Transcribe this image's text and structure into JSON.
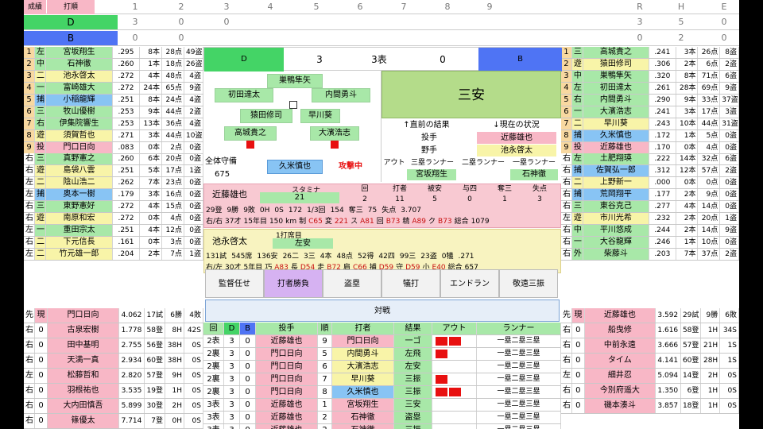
{
  "scoreboard": {
    "corner": [
      "成績",
      "打順"
    ],
    "innings": [
      "1",
      "2",
      "3",
      "4",
      "5",
      "6",
      "7",
      "8",
      "9"
    ],
    "totals_head": [
      "R",
      "H",
      "E"
    ],
    "teams": [
      {
        "name": "D",
        "runs": [
          "3",
          "0",
          "0",
          "",
          "",
          "",
          "",
          "",
          ""
        ],
        "totals": [
          "3",
          "5",
          "0"
        ]
      },
      {
        "name": "B",
        "runs": [
          "0",
          "0",
          "",
          "",
          "",
          "",
          "",
          "",
          ""
        ],
        "totals": [
          "0",
          "2",
          "0"
        ]
      }
    ]
  },
  "left_lineup": [
    {
      "no": "1",
      "pos": "左",
      "name": "宮坂翔生",
      "avg": ".295",
      "hr": "8本",
      "rbi": "28点",
      "sb": "49盗"
    },
    {
      "no": "2",
      "pos": "中",
      "name": "石神徹",
      "avg": ".260",
      "hr": "1本",
      "rbi": "18点",
      "sb": "26盗"
    },
    {
      "no": "3",
      "pos": "二",
      "name": "池永啓太",
      "avg": ".272",
      "hr": "4本",
      "rbi": "48点",
      "sb": "4盗"
    },
    {
      "no": "4",
      "pos": "一",
      "name": "富崎雄大",
      "avg": ".272",
      "hr": "24本",
      "rbi": "65点",
      "sb": "9盗"
    },
    {
      "no": "5",
      "pos": "捕",
      "name": "小稲龍輝",
      "avg": ".251",
      "hr": "8本",
      "rbi": "24点",
      "sb": "4盗"
    },
    {
      "no": "6",
      "pos": "三",
      "name": "牧山優樹",
      "avg": ".253",
      "hr": "9本",
      "rbi": "44点",
      "sb": "2盗"
    },
    {
      "no": "7",
      "pos": "右",
      "name": "伊集院響生",
      "avg": ".253",
      "hr": "13本",
      "rbi": "36点",
      "sb": "4盗"
    },
    {
      "no": "8",
      "pos": "遊",
      "name": "須賀哲也",
      "avg": ".271",
      "hr": "3本",
      "rbi": "44点",
      "sb": "10盗"
    },
    {
      "no": "9",
      "pos": "投",
      "name": "門口日向",
      "avg": ".083",
      "hr": "0本",
      "rbi": "2点",
      "sb": "0盗"
    }
  ],
  "left_bench": [
    {
      "bat": "右",
      "pos": "三",
      "name": "真野憲之",
      "avg": ".260",
      "hr": "6本",
      "rbi": "20点",
      "sb": "0盗"
    },
    {
      "bat": "右",
      "pos": "遊",
      "name": "島袋八雲",
      "avg": ".251",
      "hr": "5本",
      "rbi": "17点",
      "sb": "1盗"
    },
    {
      "bat": "左",
      "pos": "二",
      "name": "陰山浩二",
      "avg": ".262",
      "hr": "7本",
      "rbi": "23点",
      "sb": "0盗"
    },
    {
      "bat": "左",
      "pos": "捕",
      "name": "奥本一樹",
      "avg": ".179",
      "hr": "3本",
      "rbi": "16点",
      "sb": "0盗"
    },
    {
      "bat": "右",
      "pos": "三",
      "name": "東野憲好",
      "avg": ".272",
      "hr": "4本",
      "rbi": "15点",
      "sb": "0盗"
    },
    {
      "bat": "右",
      "pos": "遊",
      "name": "南原和宏",
      "avg": ".272",
      "hr": "0本",
      "rbi": "4点",
      "sb": "0盗"
    },
    {
      "bat": "左",
      "pos": "一",
      "name": "重田宗太",
      "avg": ".251",
      "hr": "4本",
      "rbi": "12点",
      "sb": "0盗"
    },
    {
      "bat": "右",
      "pos": "二",
      "name": "下元信長",
      "avg": ".161",
      "hr": "0本",
      "rbi": "3点",
      "sb": "0盗"
    },
    {
      "bat": "左",
      "pos": "二",
      "name": "竹元雄一郎",
      "avg": ".204",
      "hr": "2本",
      "rbi": "7点",
      "sb": "1盗"
    }
  ],
  "right_lineup": [
    {
      "no": "1",
      "pos": "三",
      "name": "高城貴之",
      "avg": ".241",
      "hr": "3本",
      "rbi": "26点",
      "sb": "8盗"
    },
    {
      "no": "2",
      "pos": "遊",
      "name": "猿田修司",
      "avg": ".306",
      "hr": "2本",
      "rbi": "6点",
      "sb": "2盗"
    },
    {
      "no": "3",
      "pos": "中",
      "name": "巣鴨隼矢",
      "avg": ".320",
      "hr": "8本",
      "rbi": "71点",
      "sb": "6盗"
    },
    {
      "no": "4",
      "pos": "左",
      "name": "初田達太",
      "avg": ".261",
      "hr": "28本",
      "rbi": "69点",
      "sb": "9盗"
    },
    {
      "no": "5",
      "pos": "右",
      "name": "内間勇斗",
      "avg": ".290",
      "hr": "9本",
      "rbi": "33点",
      "sb": "37盗"
    },
    {
      "no": "6",
      "pos": "一",
      "name": "大濱浩志",
      "avg": ".241",
      "hr": "3本",
      "rbi": "17点",
      "sb": "3盗"
    },
    {
      "no": "7",
      "pos": "二",
      "name": "早川葵",
      "avg": ".243",
      "hr": "10本",
      "rbi": "44点",
      "sb": "31盗"
    },
    {
      "no": "8",
      "pos": "捕",
      "name": "久米慎也",
      "avg": ".172",
      "hr": "1本",
      "rbi": "5点",
      "sb": "0盗"
    },
    {
      "no": "9",
      "pos": "投",
      "name": "近藤雄也",
      "avg": ".170",
      "hr": "0本",
      "rbi": "4点",
      "sb": "0盗"
    }
  ],
  "right_bench": [
    {
      "bat": "右",
      "pos": "左",
      "name": "土肥翔瑛",
      "avg": ".222",
      "hr": "14本",
      "rbi": "32点",
      "sb": "6盗"
    },
    {
      "bat": "右",
      "pos": "捕",
      "name": "佐賀弘一郎",
      "avg": ".312",
      "hr": "12本",
      "rbi": "57点",
      "sb": "2盗"
    },
    {
      "bat": "右",
      "pos": "二",
      "name": "上野新一",
      "avg": ".000",
      "hr": "0本",
      "rbi": "0点",
      "sb": "0盗"
    },
    {
      "bat": "右",
      "pos": "捕",
      "name": "荒岡翔平",
      "avg": ".177",
      "hr": "2本",
      "rbi": "9点",
      "sb": "0盗"
    },
    {
      "bat": "右",
      "pos": "三",
      "name": "東谷克己",
      "avg": ".277",
      "hr": "4本",
      "rbi": "14点",
      "sb": "0盗"
    },
    {
      "bat": "左",
      "pos": "遊",
      "name": "市川光希",
      "avg": ".232",
      "hr": "2本",
      "rbi": "20点",
      "sb": "1盗"
    },
    {
      "bat": "右",
      "pos": "中",
      "name": "平川悠成",
      "avg": ".244",
      "hr": "2本",
      "rbi": "14点",
      "sb": "9盗"
    },
    {
      "bat": "右",
      "pos": "一",
      "name": "大谷龍輝",
      "avg": ".246",
      "hr": "1本",
      "rbi": "10点",
      "sb": "0盗"
    },
    {
      "bat": "右",
      "pos": "外",
      "name": "柴藤斗",
      "avg": ".203",
      "hr": "7本",
      "rbi": "37点",
      "sb": "2盗"
    }
  ],
  "left_pitchers": [
    {
      "bat": "先",
      "st": "現",
      "name": "門口日向",
      "era": "4.062",
      "g": "17試",
      "w": "6勝",
      "l": "4敗"
    },
    {
      "bat": "右",
      "st": "0",
      "name": "古泉宏樹",
      "era": "1.778",
      "g": "58登",
      "w": "8H",
      "l": "42S"
    },
    {
      "bat": "右",
      "st": "0",
      "name": "田中基明",
      "era": "2.755",
      "g": "56登",
      "w": "38H",
      "l": "0S"
    },
    {
      "bat": "右",
      "st": "0",
      "name": "天満一真",
      "era": "2.934",
      "g": "60登",
      "w": "38H",
      "l": "0S"
    },
    {
      "bat": "左",
      "st": "0",
      "name": "松藤哲和",
      "era": "2.820",
      "g": "57登",
      "w": "9H",
      "l": "0S"
    },
    {
      "bat": "右",
      "st": "0",
      "name": "羽根祐也",
      "era": "3.535",
      "g": "19登",
      "w": "1H",
      "l": "0S"
    },
    {
      "bat": "右",
      "st": "0",
      "name": "大内田慎吾",
      "era": "5.899",
      "g": "30登",
      "w": "2H",
      "l": "0S"
    },
    {
      "bat": "右",
      "st": "0",
      "name": "篠優太",
      "era": "7.714",
      "g": "7登",
      "w": "0H",
      "l": "0S"
    }
  ],
  "right_pitchers": [
    {
      "bat": "先",
      "st": "現",
      "name": "近藤雄也",
      "era": "3.592",
      "g": "29試",
      "w": "9勝",
      "l": "6敗"
    },
    {
      "bat": "右",
      "st": "0",
      "name": "船曳修",
      "era": "1.616",
      "g": "58登",
      "w": "1H",
      "l": "34S"
    },
    {
      "bat": "右",
      "st": "0",
      "name": "中前永遠",
      "era": "3.666",
      "g": "57登",
      "w": "21H",
      "l": "1S"
    },
    {
      "bat": "右",
      "st": "0",
      "name": "タイム",
      "era": "4.141",
      "g": "60登",
      "w": "28H",
      "l": "1S"
    },
    {
      "bat": "左",
      "st": "0",
      "name": "細井忍",
      "era": "5.094",
      "g": "14登",
      "w": "2H",
      "l": "0S"
    },
    {
      "bat": "右",
      "st": "0",
      "name": "今別府遥大",
      "era": "1.350",
      "g": "6登",
      "w": "1H",
      "l": "0S"
    },
    {
      "bat": "右",
      "st": "0",
      "name": "磯本湊斗",
      "era": "3.857",
      "g": "18登",
      "w": "1H",
      "l": "0S"
    }
  ],
  "game": {
    "away": "D",
    "away_score": "3",
    "inning": "3表",
    "home_score": "0",
    "home": "B",
    "result": "三安",
    "field": {
      "cf": "巣鴨隼矢",
      "lf": "初田達太",
      "rf": "内間勇斗",
      "ss": "猿田修司",
      "b2": "早川葵",
      "b3": "高城貴之",
      "b1": "大濱浩志",
      "c": "久米慎也"
    },
    "defense_label": "全体守備",
    "defense_value": "675",
    "mode": "攻撃中",
    "info_heads": [
      "↑直前の結果",
      "↓現在の状況"
    ],
    "pitcher_label": "投手",
    "pitcher": "近藤雄也",
    "fielder_label": "野手",
    "fielder": "池永啓太",
    "runner_heads": [
      "アウト",
      "三塁ランナー",
      "二塁ランナー",
      "一塁ランナー"
    ],
    "runner_third": "宮坂翔生",
    "runner_first": "石神徹"
  },
  "pitcher_panel": {
    "name": "近藤雄也",
    "stamina_label": "スタミナ",
    "stamina": "21",
    "heads": [
      "回",
      "打者",
      "被安",
      "与四",
      "奪三",
      "失点"
    ],
    "vals": [
      "2",
      "11",
      "5",
      "0",
      "1",
      "3"
    ],
    "stat1": [
      "29登",
      "9勝",
      "9敗",
      "0H",
      "0S",
      "172",
      "1/3回",
      "154",
      "奪三",
      "75",
      "失点",
      "3.707"
    ],
    "stat2": [
      "右/右",
      "37才",
      "15年目",
      "150",
      "km",
      "制",
      "C65",
      "変",
      "221",
      "ス",
      "A81",
      "回",
      "B73",
      "精",
      "A89",
      "ク",
      "B73",
      "総合",
      "1079"
    ]
  },
  "batter_panel": {
    "name": "池永啓太",
    "order_label": "1打席目",
    "pos": "左安",
    "stat1": [
      "131試",
      "545席",
      "136安",
      "26二",
      "3三",
      "4本",
      "48点",
      "52得",
      "42四",
      "99三",
      "23盗",
      "0犠",
      ".271"
    ],
    "stat2": [
      "右/左",
      "30才",
      "5年目",
      "巧",
      "A83",
      "長",
      "D54",
      "走",
      "B72",
      "肩",
      "C66",
      "捕",
      "D59",
      "守",
      "D59",
      "小",
      "E40",
      "総合",
      "657"
    ]
  },
  "buttons": [
    "監督任せ",
    "打者勝負",
    "盗塁",
    "犠打",
    "エンドラン",
    "敬遠三振"
  ],
  "versus_label": "対戦",
  "log_heads": [
    "回",
    "D",
    "B",
    "投手",
    "順",
    "打者",
    "結果",
    "アウト",
    "ランナー"
  ],
  "log_rows": [
    {
      "inn": "2表",
      "d": "3",
      "b": "0",
      "pitcher": "近藤雄也",
      "no": "9",
      "batter": "門口日向",
      "result": "一ゴ",
      "outs": 2,
      "runner": "一塁二塁三塁"
    },
    {
      "inn": "2裏",
      "d": "3",
      "b": "0",
      "pitcher": "門口日向",
      "no": "5",
      "batter": "内間勇斗",
      "result": "左飛",
      "outs": 1,
      "runner": "一塁二塁三塁"
    },
    {
      "inn": "2裏",
      "d": "3",
      "b": "0",
      "pitcher": "門口日向",
      "no": "6",
      "batter": "大濱浩志",
      "result": "左安",
      "outs": 0,
      "runner": "一塁二塁三塁"
    },
    {
      "inn": "2裏",
      "d": "3",
      "b": "0",
      "pitcher": "門口日向",
      "no": "7",
      "batter": "早川葵",
      "result": "三振",
      "outs": 1,
      "runner": "一塁二塁三塁"
    },
    {
      "inn": "2裏",
      "d": "3",
      "b": "0",
      "pitcher": "門口日向",
      "no": "8",
      "batter": "久米慎也",
      "result": "三振",
      "outs": 2,
      "runner": "一塁二塁三塁"
    },
    {
      "inn": "3表",
      "d": "3",
      "b": "0",
      "pitcher": "近藤雄也",
      "no": "1",
      "batter": "宮坂翔生",
      "result": "三安",
      "outs": 0,
      "runner": "一塁二塁三塁"
    },
    {
      "inn": "3表",
      "d": "3",
      "b": "0",
      "pitcher": "近藤雄也",
      "no": "2",
      "batter": "石神徹",
      "result": "盗塁",
      "outs": 0,
      "runner": "一塁二塁三塁"
    },
    {
      "inn": "3表",
      "d": "3",
      "b": "0",
      "pitcher": "近藤雄也",
      "no": "2",
      "batter": "石神徹",
      "result": "三振",
      "outs": 0,
      "runner": "一塁二塁三塁"
    }
  ],
  "colors": {
    "team_d": "#44d466",
    "team_b": "#4f74f4",
    "pink": "#f8b7c6",
    "yellow": "#f8f4a8",
    "green": "#a8e8a8",
    "blue": "#88c4f4",
    "orange": "#f4a45c",
    "red": "#e81010",
    "lavender": "#d6b2f2"
  }
}
